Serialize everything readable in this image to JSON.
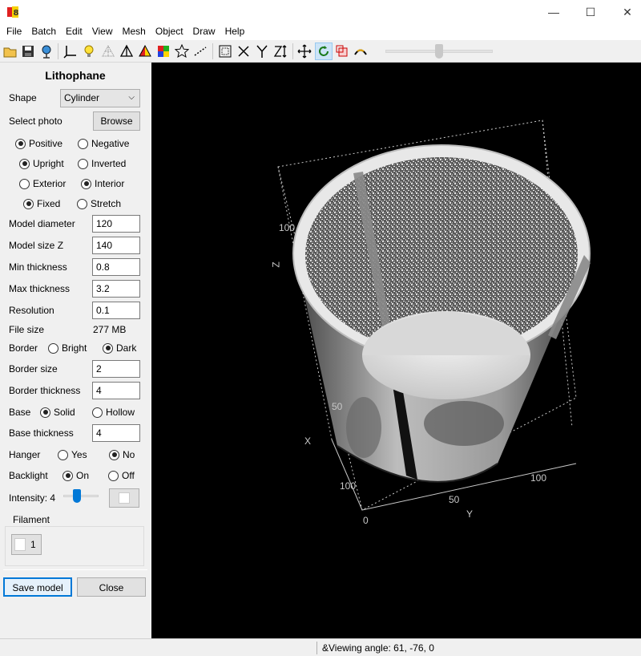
{
  "menu": [
    "File",
    "Batch",
    "Edit",
    "View",
    "Mesh",
    "Object",
    "Draw",
    "Help"
  ],
  "window_controls": {
    "minimize": "—",
    "maximize": "☐",
    "close": "✕"
  },
  "toolbar_icons": [
    "open-folder-icon",
    "save-icon",
    "globe-antenna-icon",
    "axes-icon",
    "light-bulb-icon",
    "wireframe-pyramid-icon",
    "pyramid-outline-icon",
    "pyramid-colored-icon",
    "color-palette-icon",
    "star-icon",
    "dotted-line-icon",
    "bounding-box-icon",
    "x-axis-icon",
    "y-axis-icon",
    "z-axis-icon",
    "move-icon",
    "rotate-icon",
    "scale-cube-icon",
    "arc-icon"
  ],
  "panel": {
    "title": "Lithophane",
    "shape_label": "Shape",
    "shape_value": "Cylinder",
    "select_photo_label": "Select photo",
    "browse_label": "Browse",
    "positive": "Positive",
    "negative": "Negative",
    "upright": "Upright",
    "inverted": "Inverted",
    "exterior": "Exterior",
    "interior": "Interior",
    "fixed": "Fixed",
    "stretch": "Stretch",
    "model_diameter_label": "Model diameter",
    "model_diameter": "120",
    "model_size_z_label": "Model size Z",
    "model_size_z": "140",
    "min_thickness_label": "Min thickness",
    "min_thickness": "0.8",
    "max_thickness_label": "Max thickness",
    "max_thickness": "3.2",
    "resolution_label": "Resolution",
    "resolution": "0.1",
    "file_size_label": "File size",
    "file_size": "277 MB",
    "border_label": "Border",
    "bright": "Bright",
    "dark": "Dark",
    "border_size_label": "Border size",
    "border_size": "2",
    "border_thickness_label": "Border thickness",
    "border_thickness": "4",
    "base_label": "Base",
    "solid": "Solid",
    "hollow": "Hollow",
    "base_thickness_label": "Base thickness",
    "base_thickness": "4",
    "hanger_label": "Hanger",
    "yes": "Yes",
    "no": "No",
    "backlight_label": "Backlight",
    "on": "On",
    "off": "Off",
    "intensity_label": "Intensity: 4",
    "filament_label": "Filament",
    "filament_number": "1",
    "save_model": "Save model",
    "close": "Close"
  },
  "viewport": {
    "axis_z": "Z",
    "axis_x": "X",
    "axis_y": "Y",
    "tick_z_100": "100",
    "tick_z_50": "50",
    "tick_x_100": "100",
    "tick_y_0": "0",
    "tick_y_50": "50",
    "tick_y_100": "100"
  },
  "status": {
    "text": "&Viewing angle: 61, -76, 0"
  }
}
